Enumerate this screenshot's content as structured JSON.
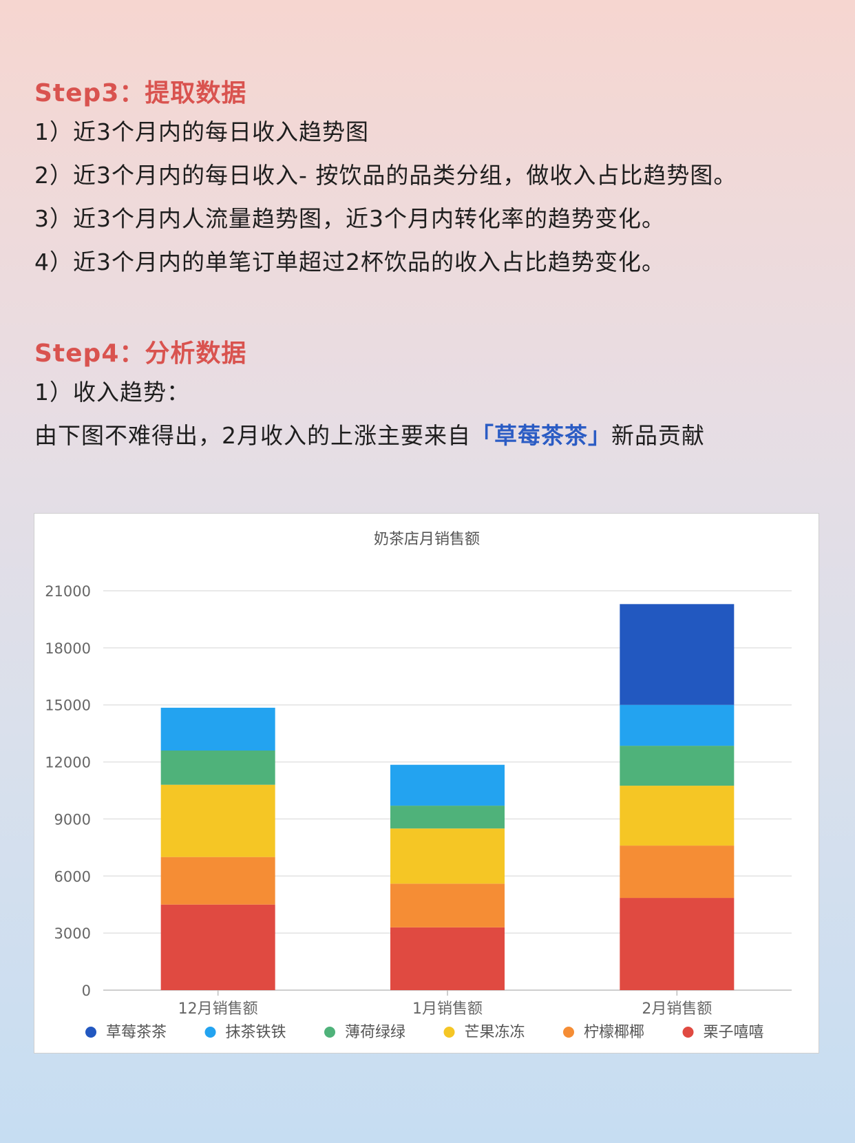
{
  "step3": {
    "title": "Step3：提取数据",
    "items": [
      "1）近3个月内的每日收入趋势图",
      "2）近3个月内的每日收入- 按饮品的品类分组，做收入占比趋势图。",
      "3）近3个月内人流量趋势图，近3个月内转化率的趋势变化。",
      "4）近3个月内的单笔订单超过2杯饮品的收入占比趋势变化。"
    ]
  },
  "step4": {
    "title": "Step4：分析数据",
    "item1": "1）收入趋势：",
    "conclusion": {
      "before": "由下图不难得出，2月收入的上涨主要来自",
      "highlight": "「草莓茶茶」",
      "after": "新品贡献"
    }
  },
  "colors": {
    "title_red": "#d9534f",
    "highlight_blue": "#2b5cc4"
  },
  "chart_data": {
    "type": "bar",
    "stacked": true,
    "title": "奶茶店月销售额",
    "categories": [
      "12月销售额",
      "1月销售额",
      "2月销售额"
    ],
    "ylim": [
      0,
      21000
    ],
    "yticks": [
      0,
      3000,
      6000,
      9000,
      12000,
      15000,
      18000,
      21000
    ],
    "grid": true,
    "legend_position": "bottom",
    "series": [
      {
        "name": "栗子嘻嘻",
        "color": "#e04a41",
        "values": [
          4500,
          3300,
          4850
        ]
      },
      {
        "name": "柠檬椰椰",
        "color": "#f58d35",
        "values": [
          2500,
          2300,
          2750
        ]
      },
      {
        "name": "芒果冻冻",
        "color": "#f5c625",
        "values": [
          3800,
          2900,
          3150
        ]
      },
      {
        "name": "薄荷绿绿",
        "color": "#4fb27a",
        "values": [
          1800,
          1200,
          2100
        ]
      },
      {
        "name": "抹茶铁铁",
        "color": "#23a3f0",
        "values": [
          2250,
          2150,
          2150
        ]
      },
      {
        "name": "草莓茶茶",
        "color": "#2258c0",
        "values": [
          0,
          0,
          5300
        ]
      }
    ],
    "legend_order": [
      "草莓茶茶",
      "抹茶铁铁",
      "薄荷绿绿",
      "芒果冻冻",
      "柠檬椰椰",
      "栗子嘻嘻"
    ]
  }
}
